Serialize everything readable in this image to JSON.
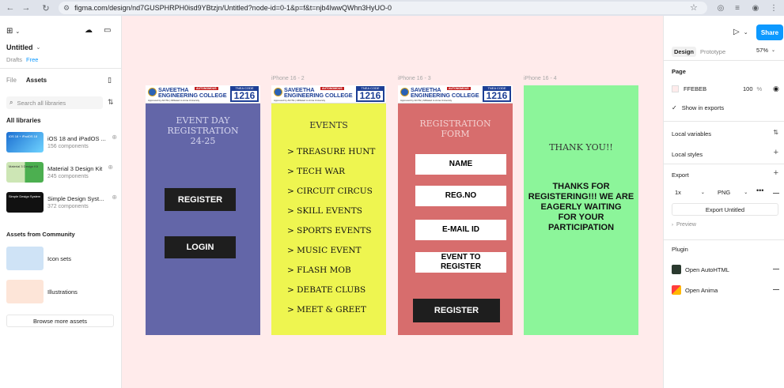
{
  "browser": {
    "url": "figma.com/design/nd7GUSPHRPH0isd9YBtzjn/Untitled?node-id=0-1&p=f&t=njb4IwwQWhn3HyUO-0"
  },
  "left_panel": {
    "file_name": "Untitled",
    "drafts_label": "Drafts",
    "plan_label": "Free",
    "tab_file": "File",
    "tab_assets": "Assets",
    "search_placeholder": "Search all libraries",
    "all_libraries_heading": "All libraries",
    "libraries": [
      {
        "name": "iOS 18 and iPadOS ...",
        "count": "156 components",
        "thumb_text": "iOS 18 + iPadOS 18",
        "color": "#1c6fd1"
      },
      {
        "name": "Material 3 Design Kit",
        "count": "245 components",
        "thumb_text": "Material 3 Design Kit",
        "color": "#4caf50"
      },
      {
        "name": "Simple Design Syst...",
        "count": "372 components",
        "thumb_text": "Simple Design System",
        "color": "#111111"
      }
    ],
    "community_heading": "Assets from Community",
    "community": [
      {
        "name": "Icon sets"
      },
      {
        "name": "Illustrations"
      }
    ],
    "browse_button": "Browse more assets"
  },
  "canvas": {
    "background": "#ffebeb",
    "frame_labels": [
      "iPhone 16 - 2",
      "iPhone 16 - 3",
      "iPhone 16 - 4"
    ],
    "header": {
      "title_line1": "SAVEETHA",
      "title_line2": "ENGINEERING COLLEGE",
      "autonomous": "AUTONOMOUS",
      "approval": "Approved by AICTE | Affiliated to Anna University",
      "code_label": "TNEA CODE",
      "code": "1216"
    },
    "frame1": {
      "color": "#6366a8",
      "title_line1": "EVENT DAY",
      "title_line2": "REGISTRATION",
      "title_line3": "24-25",
      "register_button": "REGISTER",
      "login_button": "LOGIN"
    },
    "frame2": {
      "color": "#eef550",
      "title": "EVENTS",
      "items": [
        "> TREASURE HUNT",
        "> TECH WAR",
        "> CIRCUIT CIRCUS",
        "> SKILL EVENTS",
        "> SPORTS EVENTS",
        "> MUSIC EVENT",
        "> FLASH MOB",
        "> DEBATE CLUBS",
        "> MEET & GREET"
      ]
    },
    "frame3": {
      "color": "#d76d6d",
      "title_line1": "REGISTRATION",
      "title_line2": "FORM",
      "fields": [
        "NAME",
        "REG.NO",
        "E-MAIL ID"
      ],
      "event_field_line1": "EVENT TO",
      "event_field_line2": "REGISTER",
      "register_button": "REGISTER"
    },
    "frame4": {
      "color": "#8cf59a",
      "title": "THANK YOU!!",
      "message_line1": "THANKS FOR",
      "message_line2": "REGISTERING!!! WE ARE",
      "message_line3": "EAGERLY WAITING",
      "message_line4": "FOR YOUR",
      "message_line5": "PARTICIPATION"
    }
  },
  "right_panel": {
    "share_button": "Share",
    "tab_design": "Design",
    "tab_prototype": "Prototype",
    "zoom": "57%",
    "page_heading": "Page",
    "page_color": "FFEBEB",
    "page_opacity": "100",
    "percent": "%",
    "show_in_exports": "Show in exports",
    "local_variables": "Local variables",
    "local_styles": "Local styles",
    "export_heading": "Export",
    "export_scale": "1x",
    "export_format": "PNG",
    "export_button": "Export Untitled",
    "preview": "Preview",
    "plugin_heading": "Plugin",
    "plugins": [
      "Open AutoHTML",
      "Open Anima"
    ]
  }
}
